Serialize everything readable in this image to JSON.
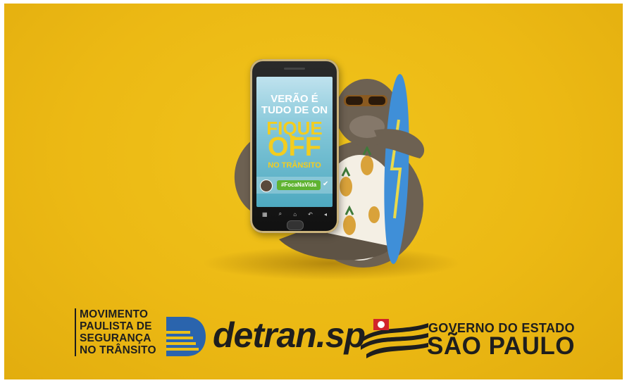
{
  "phone_screen": {
    "line1": "VERÃO É",
    "line2": "TUDO DE ON",
    "line3": "FIQUE",
    "line4": "OFF",
    "line5": "NO TRÂNSITO",
    "hashtag": "#FocaNaVida"
  },
  "campaign": {
    "lines": [
      "MOVIMENTO",
      "PAULISTA DE",
      "SEGURANÇA",
      "NO TRÂNSITO"
    ]
  },
  "detran": {
    "name": "detran.sp"
  },
  "governo": {
    "line1": "GOVERNO DO ESTADO",
    "line2": "SÃO PAULO"
  },
  "colors": {
    "background": "#ecb914",
    "screen_text_accent": "#f3cd1f",
    "hashtag_badge": "#5fb331",
    "logo_text": "#1e1e1e",
    "detran_blue": "#2a64ad",
    "sp_red": "#d1232a"
  },
  "icons": {
    "mascot": "seal-with-sunglasses-icon",
    "surfboard": "surfboard-icon",
    "detran_logo": "detran-d-icon",
    "sp_flag": "sao-paulo-flag-icon"
  }
}
